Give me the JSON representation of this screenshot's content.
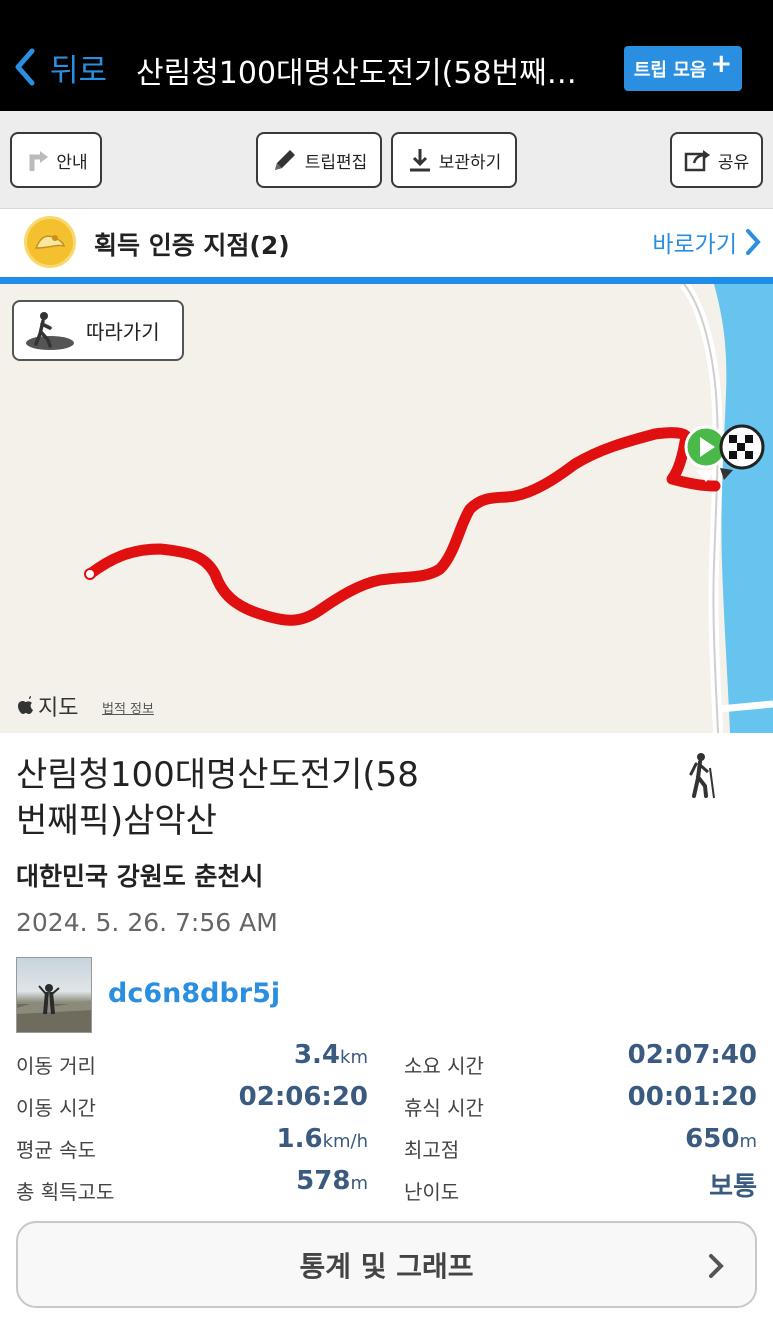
{
  "nav": {
    "back_label": "뒤로",
    "title": "산림청100대명산도전기(58번째…",
    "trip_collection_label": "트립 모음"
  },
  "toolbar": {
    "guide_label": "안내",
    "edit_label": "트립편집",
    "save_label": "보관하기",
    "share_label": "공유"
  },
  "certification": {
    "label": "획득 인증 지점(2)",
    "goto_label": "바로가기"
  },
  "map": {
    "follow_label": "따라가기",
    "attribution": "지도",
    "legal_label": "법적 정보",
    "route_color": "#e01010"
  },
  "trip": {
    "title_line1": "산림청100대명산도전기(58",
    "title_line2": "번째픽)삼악산",
    "region": "대한민국 강원도 춘천시",
    "datetime": "2024. 5. 26. 7:56 AM",
    "username": "dc6n8dbr5j"
  },
  "stats": {
    "distance": {
      "label": "이동 거리",
      "value": "3.4",
      "unit": "km"
    },
    "total_time": {
      "label": "소요 시간",
      "value": "02:07:40",
      "unit": ""
    },
    "moving_time": {
      "label": "이동 시간",
      "value": "02:06:20",
      "unit": ""
    },
    "rest_time": {
      "label": "휴식 시간",
      "value": "00:01:20",
      "unit": ""
    },
    "avg_speed": {
      "label": "평균 속도",
      "value": "1.6",
      "unit": "km/h"
    },
    "max_altitude": {
      "label": "최고점",
      "value": "650",
      "unit": "m"
    },
    "total_ascent": {
      "label": "총 획득고도",
      "value": "578",
      "unit": "m"
    },
    "difficulty": {
      "label": "난이도",
      "value": "보통",
      "unit": ""
    }
  },
  "stats_button_label": "통계 및 그래프",
  "colors": {
    "accent": "#2a8fe0",
    "stat_value": "#3a5a80",
    "water": "#66c4ee"
  }
}
